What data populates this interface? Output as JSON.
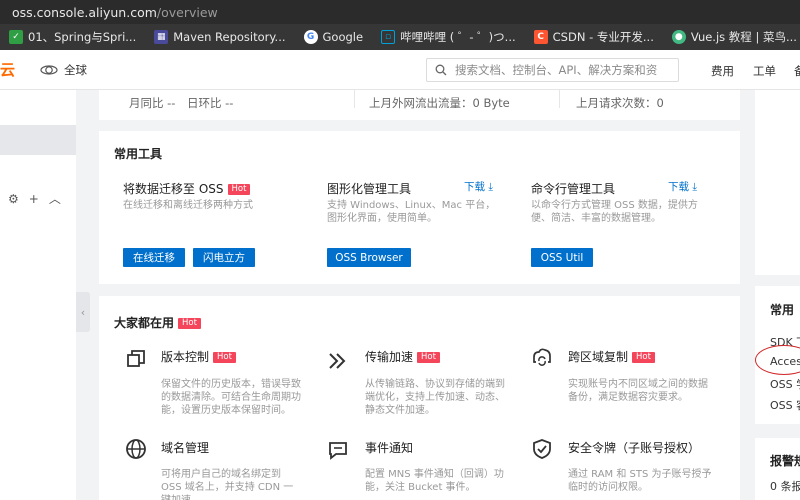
{
  "browser": {
    "address_host": "oss.console.aliyun.com",
    "address_path": "/overview",
    "bookmarks": [
      {
        "icon": "bookmark-green-icon",
        "color": "#2f9e44",
        "label": "01、Spring与Spri..."
      },
      {
        "icon": "maven-icon",
        "color": "#4a4a9a",
        "label": "Maven Repository..."
      },
      {
        "icon": "google-icon",
        "color": "#4285f4",
        "label": "Google"
      },
      {
        "icon": "bilibili-icon",
        "color": "#00a1d6",
        "label": "哔哩哔哩 ( ゜- ゜)つ..."
      },
      {
        "icon": "csdn-icon",
        "color": "#fc5531",
        "label": "CSDN - 专业开发..."
      },
      {
        "icon": "vue-icon",
        "color": "#42b883",
        "label": "Vue.js 教程 | 菜鸟..."
      }
    ]
  },
  "header": {
    "logo_text": "云",
    "region_label": "全球",
    "search_placeholder": "搜索文档、控制台、API、解决方案和资",
    "links": [
      "费用",
      "工单",
      "备"
    ]
  },
  "stats": {
    "mom_label": "月同比",
    "mom_value": "--",
    "dod_label": "日环比",
    "dod_value": "--",
    "traffic_label": "上月外网流出流量：",
    "traffic_value": "0 Byte",
    "requests_label": "上月请求次数：",
    "requests_value": "0"
  },
  "tools_card": {
    "title": "常用工具",
    "hot_label": "Hot",
    "download_label": "下载",
    "tools": [
      {
        "name": "将数据迁移至 OSS",
        "hot": true,
        "desc": "在线迁移和离线迁移两种方式",
        "buttons": [
          "在线迁移",
          "闪电立方"
        ]
      },
      {
        "name": "图形化管理工具",
        "desc": "支持 Windows、Linux、Mac 平台，图形化界面，使用简单。",
        "buttons": [
          "OSS Browser"
        ]
      },
      {
        "name": "命令行管理工具",
        "desc": "以命令行方式管理 OSS 数据，提供方便、简洁、丰富的数据管理。",
        "buttons": [
          "OSS Util"
        ]
      }
    ]
  },
  "popular_card": {
    "title": "大家都在用",
    "hot_label": "Hot",
    "features": [
      {
        "icon": "copy-icon",
        "name": "版本控制",
        "hot": true,
        "desc": "保留文件的历史版本，错误导致的数据清除。可结合生命周期功能，设置历史版本保留时间。"
      },
      {
        "icon": "double-chevron-icon",
        "name": "传输加速",
        "hot": true,
        "desc": "从传输链路、协议到存储的端到端优化，支持上传加速、动态、静态文件加速。"
      },
      {
        "icon": "cloud-sync-icon",
        "name": "跨区域复制",
        "hot": true,
        "desc": "实现账号内不同区域之间的数据备份，满足数据容灾要求。"
      },
      {
        "icon": "globe-icon",
        "name": "域名管理",
        "hot": false,
        "desc": "可将用户自己的域名绑定到 OSS 域名上，并支持 CDN 一键加速"
      },
      {
        "icon": "message-icon",
        "name": "事件通知",
        "hot": false,
        "desc": "配置 MNS 事件通知（回调）功能，关注 Bucket 事件。"
      },
      {
        "icon": "shield-check-icon",
        "name": "安全令牌（子账号授权）",
        "hot": false,
        "desc": "通过 RAM 和 STS 为子账号授予临时的访问权限。"
      }
    ]
  },
  "right_panel": {
    "common_title": "常用",
    "links": [
      "SDK 下",
      "Acces",
      "OSS 学",
      "OSS 客"
    ],
    "alert_title": "报警规",
    "alert_text": "0 条报"
  }
}
